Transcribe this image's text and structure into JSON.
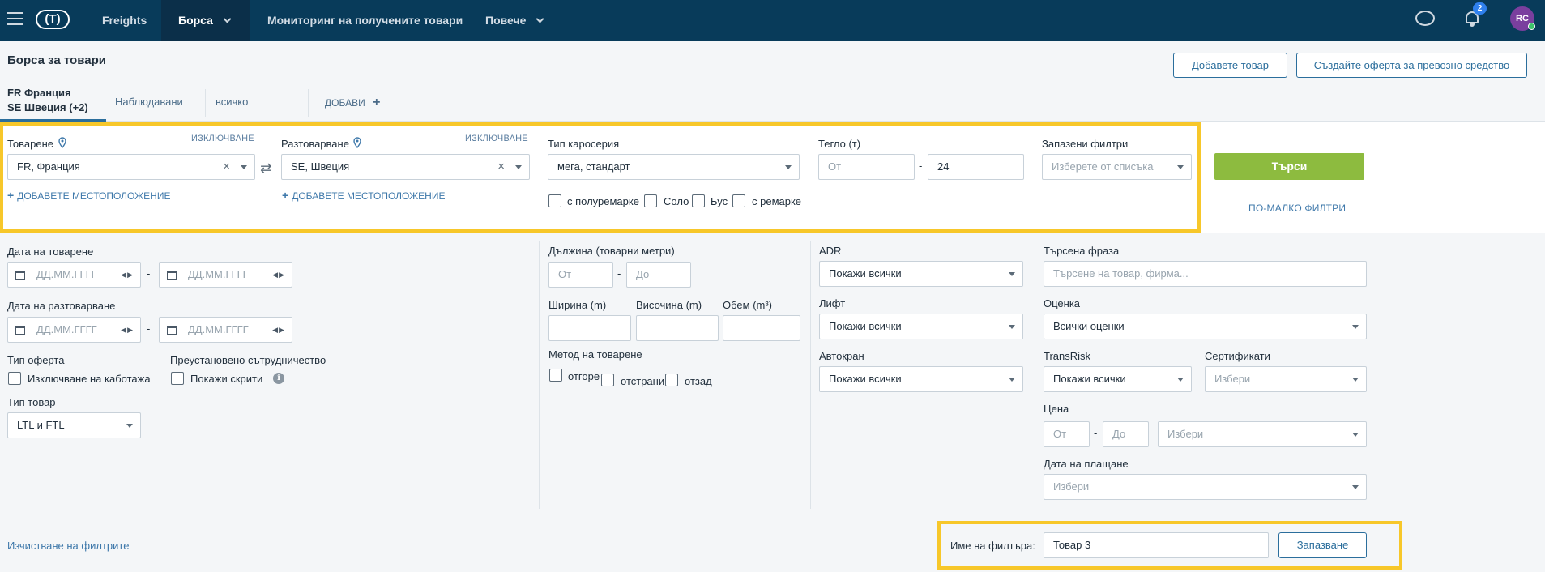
{
  "nav": {
    "items": [
      "Freights",
      "Борса",
      "Мониторинг на получените товари",
      "Повече"
    ],
    "notifications_count": "2",
    "avatar_initials": "RC"
  },
  "header": {
    "title": "Борса за товари",
    "add_cargo_button": "Добавете товар",
    "create_vehicle_offer_button": "Създайте оферта за превозно средство"
  },
  "tabs": {
    "active_line1": "FR Франция",
    "active_line2": "SE Швеция (+2)",
    "watched": "Наблюдавани",
    "all": "всичко",
    "add": "ДОБАВИ"
  },
  "filters_top": {
    "loading_label": "Товарене",
    "loading_exclude": "ИЗКЛЮЧВАНЕ",
    "loading_value": "FR,  Франция",
    "unloading_label": "Разтоварване",
    "unloading_exclude": "ИЗКЛЮЧВАНЕ",
    "unloading_value": "SE,  Швеция",
    "add_location": "ДОБАВЕТЕ МЕСТОПОЛОЖЕНИЕ",
    "body_type_label": "Тип каросерия",
    "body_type_value": "мега, стандарт",
    "body_options": [
      "с полуремарке",
      "Соло",
      "Бус",
      "с ремарке"
    ],
    "weight_label": "Тегло (т)",
    "weight_from_placeholder": "От",
    "weight_to_value": "24",
    "saved_filters_label": "Запазени филтри",
    "saved_filters_placeholder": "Изберете от списъка",
    "search_button": "Търси",
    "fewer_filters": "ПО-МАЛКО ФИЛТРИ"
  },
  "filters_main": {
    "loading_date_label": "Дата на товарене",
    "unloading_date_label": "Дата на разтоварване",
    "date_placeholder": "ДД.ММ.ГГГГ",
    "offer_type_label": "Тип оферта",
    "exclude_cabotage": "Изключване на каботажа",
    "suspended_coop_label": "Преустановено сътрудничество",
    "show_hidden": "Покажи скрити",
    "cargo_type_label": "Тип товар",
    "cargo_type_value": "LTL и FTL",
    "length_label": "Дължина (товарни метри)",
    "from_placeholder": "От",
    "to_placeholder": "До",
    "width_label": "Ширина (m)",
    "height_label": "Височина (m)",
    "volume_label": "Обем (m³)",
    "loading_method_label": "Метод на товарене",
    "loading_methods": [
      "отгоре",
      "отстрани",
      "отзад"
    ],
    "adr_label": "ADR",
    "adr_value": "Покажи всички",
    "lift_label": "Лифт",
    "lift_value": "Покажи всички",
    "crane_label": "Автокран",
    "crane_value": "Покажи всички",
    "phrase_label": "Търсена фраза",
    "phrase_placeholder": "Търсене на товар, фирма...",
    "rating_label": "Оценка",
    "rating_value": "Всички оценки",
    "transrisk_label": "TransRisk",
    "transrisk_value": "Покажи всички",
    "certificates_label": "Сертификати",
    "certificates_placeholder": "Избери",
    "price_label": "Цена",
    "price_currency_placeholder": "Избери",
    "payment_date_label": "Дата на плащане",
    "payment_date_placeholder": "Избери"
  },
  "footer": {
    "clear_filters": "Изчистване на филтрите",
    "filter_name_label": "Име на филтъра:",
    "filter_name_value": "Товар 3",
    "save_button": "Запазване"
  },
  "colors": {
    "nav_bg": "#083b5a",
    "accent": "#2b6e9c",
    "search_button": "#8dbb3f",
    "highlight": "#f7c72a"
  }
}
